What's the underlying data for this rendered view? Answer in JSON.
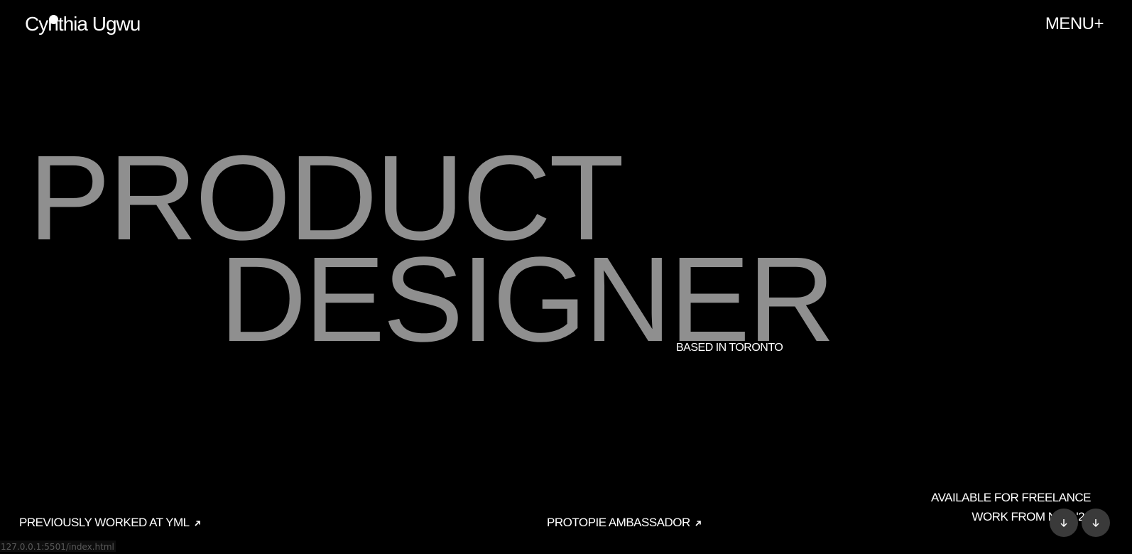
{
  "header": {
    "logo_text": "Cynthia Ugwu",
    "menu_label": "MENU+"
  },
  "hero": {
    "line1": "PRODUCT",
    "line2": "DESIGNER",
    "location": "BASED IN TORONTO"
  },
  "footer": {
    "links": [
      {
        "label": "PREVIOUSLY WORKED AT YML",
        "icon": "arrow-up-right-icon"
      },
      {
        "label": "PROTOPIE AMBASSADOR",
        "icon": "arrow-up-right-icon"
      }
    ],
    "availability": {
      "line1": "AVAILABLE FOR FREELANCE",
      "line2": "WORK FROM NOV '23"
    },
    "scroll_buttons": [
      {
        "icon": "arrow-down-icon"
      },
      {
        "icon": "arrow-down-icon"
      }
    ]
  },
  "status_bar": {
    "url": "127.0.0.1:5501/index.html"
  },
  "colors": {
    "background": "#000000",
    "hero_text": "#8f8f8f",
    "foreground": "#ffffff",
    "button_bg": "#3a3a3a"
  }
}
